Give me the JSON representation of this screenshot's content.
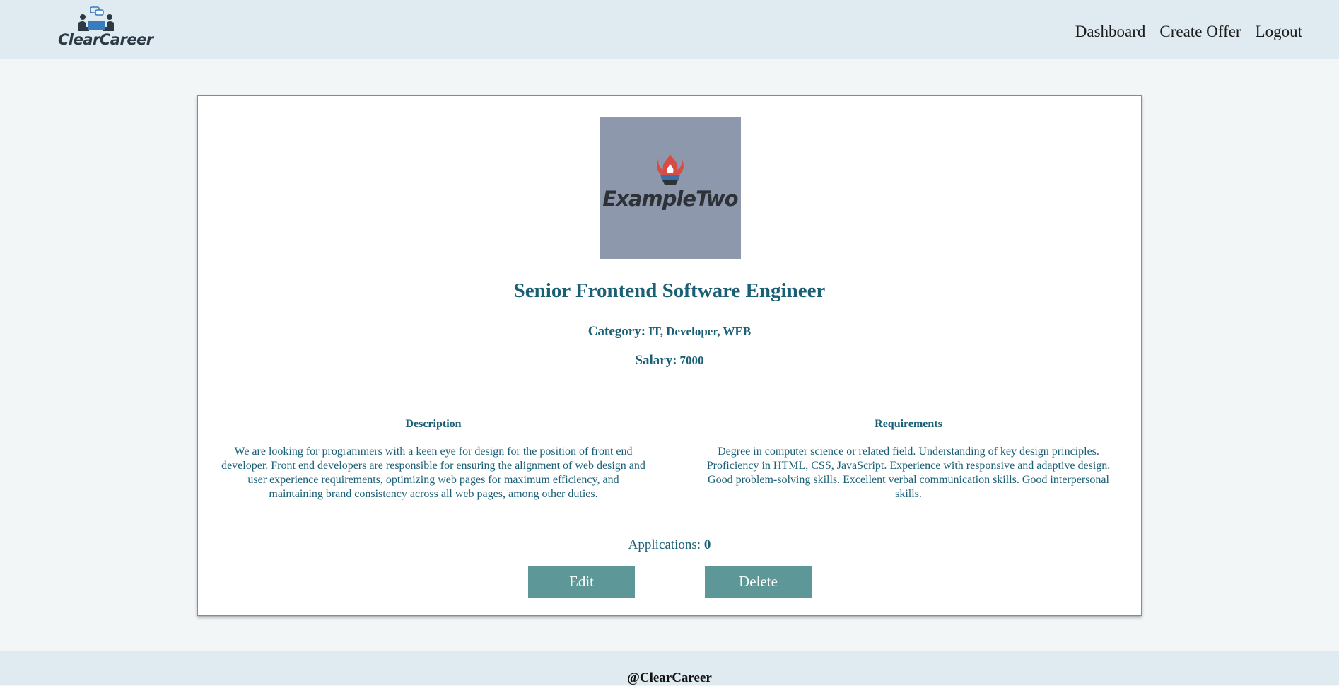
{
  "header": {
    "brand": "ClearCareer",
    "nav": {
      "dashboard": "Dashboard",
      "create_offer": "Create Offer",
      "logout": "Logout"
    },
    "background": "#e0eaf1"
  },
  "offer": {
    "company_logo_text": "ExampleTwo",
    "title": "Senior Frontend Software Engineer",
    "category_label": "Category:",
    "category_value": "IT, Developer, WEB",
    "salary_label": "Salary:",
    "salary_value": "7000",
    "description_heading": "Description",
    "description_text": "We are looking for programmers with a keen eye for design for the position of front end developer. Front end developers are responsible for ensuring the alignment of web design and user experience requirements, optimizing web pages for maximum efficiency, and maintaining brand consistency across all web pages, among other duties.",
    "requirements_heading": "Requirements",
    "requirements_text": "Degree in computer science or related field. Understanding of key design principles. Proficiency in HTML, CSS, JavaScript. Experience with responsive and adaptive design. Good problem-solving skills. Excellent verbal communication skills. Good interpersonal skills.",
    "applications_label": "Applications:",
    "applications_count": "0",
    "edit_label": "Edit",
    "delete_label": "Delete"
  },
  "footer": {
    "text": "@ClearCareer"
  },
  "colors": {
    "accent_text": "#1a5f75",
    "button": "#5d9797",
    "logo_bg": "#8d98ac",
    "page_bg": "#f2f6f7"
  },
  "icons": [
    "clearcareer-logo-icon",
    "flame-brazier-icon"
  ]
}
